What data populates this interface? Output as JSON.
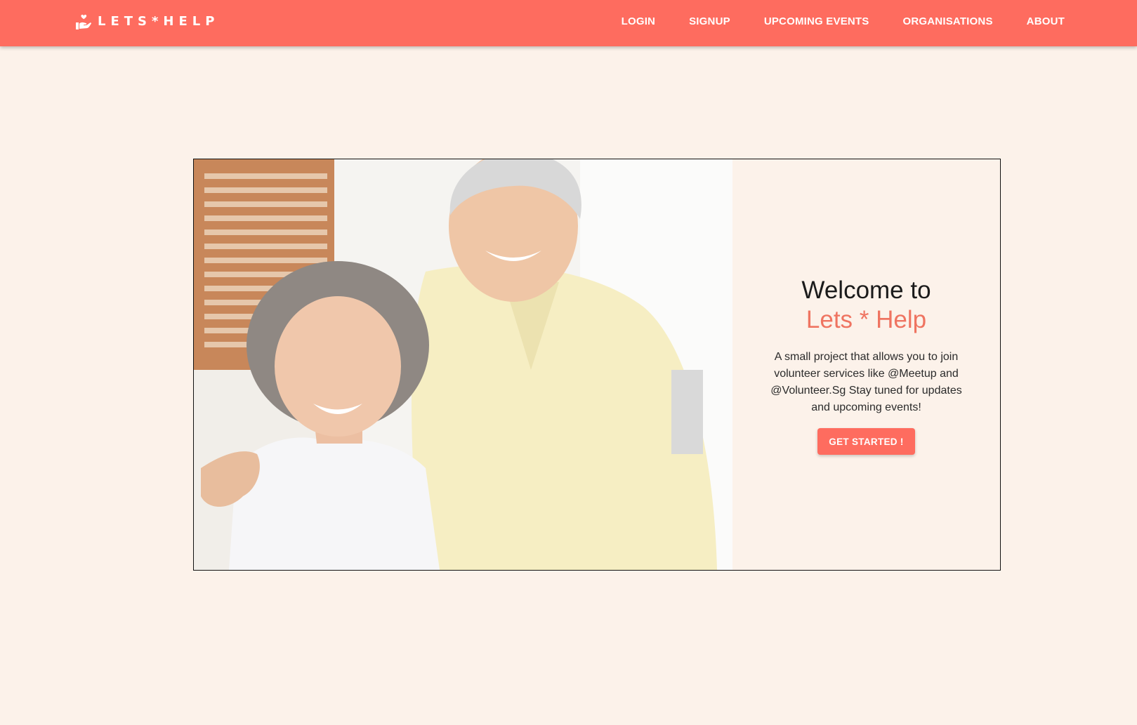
{
  "navbar": {
    "brand": {
      "text": "LETS*HELP",
      "icon": "hand-holding-heart-icon"
    },
    "links": [
      {
        "label": "LOGIN"
      },
      {
        "label": "SIGNUP"
      },
      {
        "label": "UPCOMING EVENTS"
      },
      {
        "label": "ORGANISATIONS"
      },
      {
        "label": "ABOUT"
      }
    ]
  },
  "hero": {
    "image_subject": "smiling-elderly-couple-photo",
    "welcome": "Welcome to",
    "brand_name": "Lets * Help",
    "description": "A small project that allows you to join volunteer services like @Meetup and @Volunteer.Sg Stay tuned for updates and upcoming events!",
    "cta_label": "GET STARTED !"
  },
  "colors": {
    "accent": "#fe6c5f",
    "brand_text": "#ef7461",
    "background": "#fcf2ea"
  }
}
